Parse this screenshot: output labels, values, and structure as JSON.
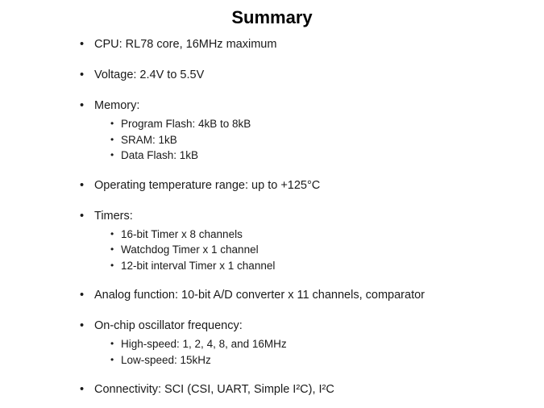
{
  "slide": {
    "title": "Summary",
    "bullet_glyph": "•",
    "text_color": "#1a1a1a",
    "background_color": "#ffffff",
    "bullets": [
      {
        "text": "CPU: RL78 core, 16MHz maximum",
        "children": []
      },
      {
        "text": "Voltage: 2.4V to 5.5V",
        "children": []
      },
      {
        "text": "Memory:",
        "children": [
          "Program Flash: 4kB to 8kB",
          "SRAM: 1kB",
          "Data Flash: 1kB"
        ]
      },
      {
        "text": "Operating temperature range: up to +125°C",
        "children": []
      },
      {
        "text": "Timers:",
        "children": [
          "16-bit Timer x 8 channels",
          "Watchdog Timer x 1 channel",
          "12-bit interval Timer x 1 channel"
        ]
      },
      {
        "text": "Analog function: 10-bit A/D converter x 11 channels, comparator",
        "children": []
      },
      {
        "text": "On-chip oscillator frequency:",
        "children": [
          "High-speed: 1, 2, 4, 8, and 16MHz",
          "Low-speed: 15kHz"
        ]
      },
      {
        "text": "Connectivity: SCI (CSI, UART, Simple I²C), I²C",
        "children": []
      }
    ]
  }
}
